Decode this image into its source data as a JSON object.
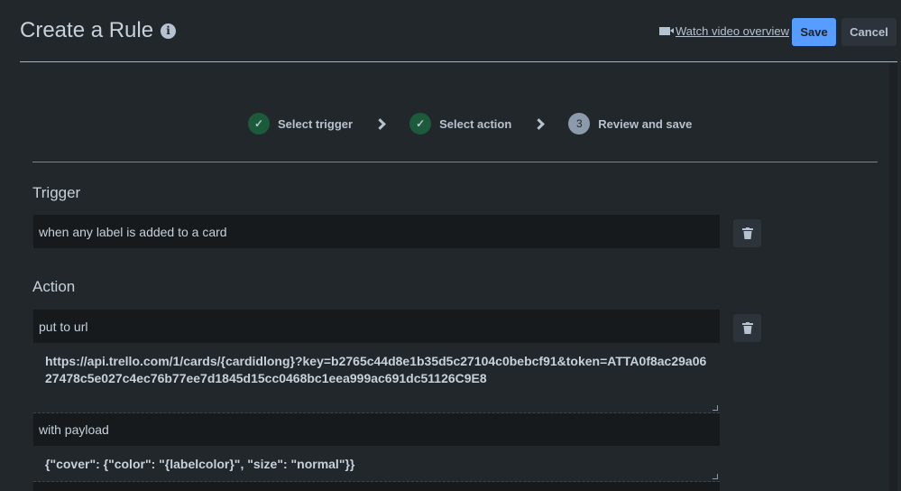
{
  "header": {
    "title": "Create a Rule",
    "video_link": "Watch video overview",
    "save": "Save",
    "cancel": "Cancel"
  },
  "steps": [
    {
      "label": "Select trigger",
      "state": "done"
    },
    {
      "label": "Select action",
      "state": "done"
    },
    {
      "number": "3",
      "label": "Review and save",
      "state": "current"
    }
  ],
  "trigger": {
    "heading": "Trigger",
    "value": "when any label is added to a card"
  },
  "action": {
    "heading": "Action",
    "type": "put to url",
    "url": "https://api.trello.com/1/cards/{cardidlong}?key=b2765c44d8e1b35d5c27104c0bebcf91&token=ATTA0f8ac29a0627478c5e027c4ec76b77ee7d1845d15cc0468bc1eea999ac691dc51126C9E8",
    "payload_label": "with payload",
    "payload": "{\"cover\": {\"color\": \"{labelcolor}\", \"size\": \"normal\"}}"
  },
  "colors": {
    "accent": "#579dff",
    "success": "#1c5a3c",
    "background": "#22272b"
  }
}
